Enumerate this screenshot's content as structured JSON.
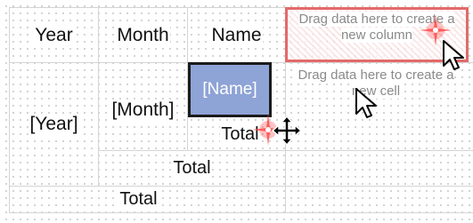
{
  "header": {
    "year": "Year",
    "month": "Month",
    "name": "Name",
    "column_drop_hint": "Drag data here to create a new column"
  },
  "rows": {
    "year_field": "[Year]",
    "month_field": "[Month]",
    "name_field": "[Name]",
    "cell_drop_hint": "Drag data here to create a new cell",
    "name_total": "Total",
    "month_total": "Total",
    "grand_total": "Total"
  },
  "colors": {
    "selection_fill": "#8ea3d6",
    "selection_border": "#1b1b1b",
    "drop_target_border": "#e36a6a",
    "grid_line": "#d4d4d4"
  },
  "icons": {
    "move_cursor": "move-icon",
    "pointer_cursor": "arrow-cursor-icon",
    "highlight": "sparkle-icon"
  }
}
